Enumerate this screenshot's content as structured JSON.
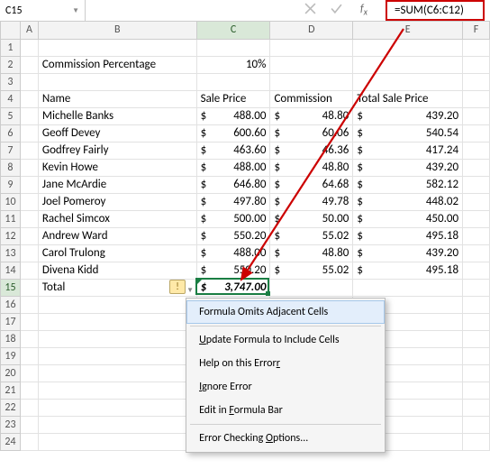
{
  "name_box": "C15",
  "formula": "=SUM(C6:C12)",
  "columns": [
    "A",
    "B",
    "C",
    "D",
    "E",
    "F"
  ],
  "rows_visible": 24,
  "commission_label": "Commission Percentage",
  "commission_value": "10%",
  "headers": {
    "name": "Name",
    "price": "Sale Price",
    "comm": "Commission",
    "total": "Total Sale Price"
  },
  "data_rows": [
    {
      "name": "Michelle Banks",
      "price": "488.00",
      "comm": "48.80",
      "total": "439.20"
    },
    {
      "name": "Geoff Devey",
      "price": "600.60",
      "comm": "60.06",
      "total": "540.54"
    },
    {
      "name": "Godfrey Fairly",
      "price": "463.60",
      "comm": "46.36",
      "total": "417.24"
    },
    {
      "name": "Kevin Howe",
      "price": "488.00",
      "comm": "48.80",
      "total": "439.20"
    },
    {
      "name": "Jane McArdie",
      "price": "646.80",
      "comm": "64.68",
      "total": "582.12"
    },
    {
      "name": "Joel Pomeroy",
      "price": "497.80",
      "comm": "49.78",
      "total": "448.02"
    },
    {
      "name": "Rachel Simcox",
      "price": "500.00",
      "comm": "50.00",
      "total": "450.00"
    },
    {
      "name": "Andrew Ward",
      "price": "550.20",
      "comm": "55.02",
      "total": "495.18"
    },
    {
      "name": "Carol Trulong",
      "price": "488.00",
      "comm": "48.80",
      "total": "439.20"
    },
    {
      "name": "Divena Kidd",
      "price": "550.20",
      "comm": "55.02",
      "total": "495.18"
    }
  ],
  "total_label": "Total",
  "total_value": "3,747.00",
  "menu": {
    "item1": "Formula Omits Adjacent Cells",
    "item2": "Update Formula to Include Cells",
    "item3": "Help on this Error",
    "item4": "Ignore Error",
    "item5": "Edit in Formula Bar",
    "item6": "Error Checking Options..."
  }
}
